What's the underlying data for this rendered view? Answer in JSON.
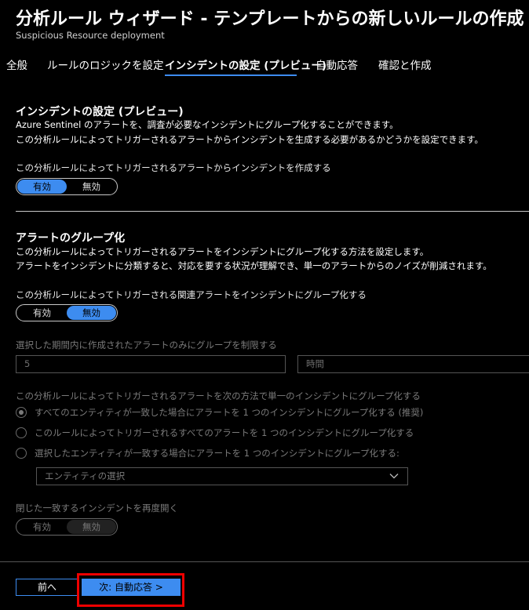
{
  "header": {
    "title": "分析ルール ウィザード - テンプレートからの新しいルールの作成",
    "subtitle": "Suspicious Resource deployment"
  },
  "tabs": [
    {
      "label": "全般",
      "active": false
    },
    {
      "label": "ルールのロジックを設定",
      "active": false
    },
    {
      "label": "インシデントの設定 (プレビュー)",
      "active": true
    },
    {
      "label": "自動応答",
      "active": false
    },
    {
      "label": "確認と作成",
      "active": false
    }
  ],
  "incident": {
    "heading": "インシデントの設定 (プレビュー)",
    "desc1": "Azure Sentinel のアラートを、調査が必要なインシデントにグループ化することができます。",
    "desc2": "この分析ルールによってトリガーされるアラートからインシデントを生成する必要があるかどうかを設定できます。",
    "create_label": "この分析ルールによってトリガーされるアラートからインシデントを作成する",
    "toggle_on": "有効",
    "toggle_off": "無効",
    "selected": "有効"
  },
  "grouping": {
    "heading": "アラートのグループ化",
    "desc1": "この分析ルールによってトリガーされるアラートをインシデントにグループ化する方法を設定します。",
    "desc2": "アラートをインシデントに分類すると、対応を要する状況が理解でき、単一のアラートからのノイズが削減されます。",
    "group_label": "この分析ルールによってトリガーされる関連アラートをインシデントにグループ化する",
    "toggle_on": "有効",
    "toggle_off": "無効",
    "selected": "無効",
    "limit_label": "選択した期間内に作成されたアラートのみにグループを制限する",
    "limit_value": "5",
    "limit_unit": "時間",
    "method_label": "この分析ルールによってトリガーされるアラートを次の方法で単一のインシデントにグループ化する",
    "options": [
      "すべてのエンティティが一致した場合にアラートを 1 つのインシデントにグループ化する (推奨)",
      "このルールによってトリガーされるすべてのアラートを 1 つのインシデントにグループ化する",
      "選択したエンティティが一致する場合にアラートを 1 つのインシデントにグループ化する:"
    ],
    "selected_option": 0,
    "entity_placeholder": "エンティティの選択",
    "reopen_label": "閉じた一致するインシデントを再度開く",
    "reopen_on": "有効",
    "reopen_off": "無効",
    "reopen_selected": "無効"
  },
  "footer": {
    "prev": "前へ",
    "next": "次: 自動応答 >"
  },
  "colors": {
    "accent": "#3d8cf0",
    "highlight": "#e00000",
    "background": "#000000"
  }
}
